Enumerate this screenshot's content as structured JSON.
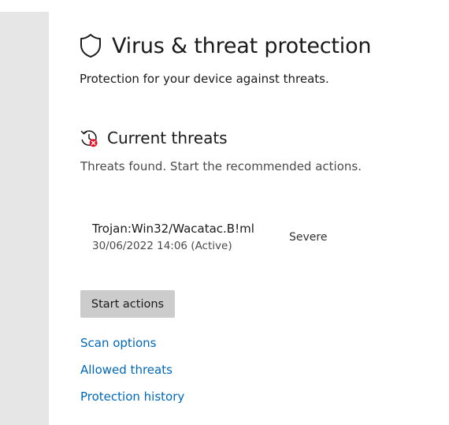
{
  "page": {
    "title": "Virus & threat protection",
    "subtitle": "Protection for your device against threats."
  },
  "current_threats": {
    "title": "Current threats",
    "description": "Threats found. Start the recommended actions.",
    "threats": [
      {
        "name": "Trojan:Win32/Wacatac.B!ml",
        "detected": "30/06/2022 14:06 (Active)",
        "severity": "Severe"
      }
    ],
    "start_button_label": "Start actions"
  },
  "links": {
    "scan_options": "Scan options",
    "allowed_threats": "Allowed threats",
    "protection_history": "Protection history"
  },
  "icons": {
    "page_icon": "shield-icon",
    "section_icon": "history-alert-icon"
  },
  "colors": {
    "link": "#0067b8",
    "alert": "#e81123",
    "button_bg": "#cccccc",
    "sidebar_bg": "#e6e6e6"
  }
}
